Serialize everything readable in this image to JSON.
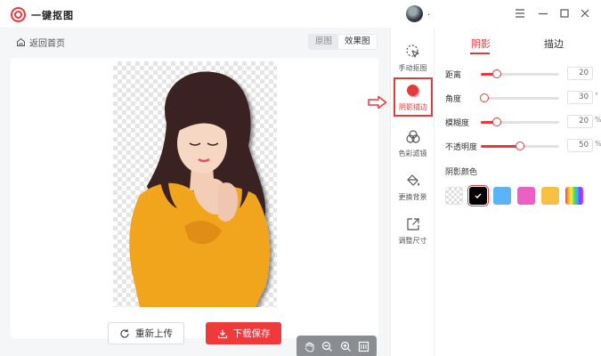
{
  "app": {
    "title": "一键抠图",
    "username": "."
  },
  "left": {
    "back_label": "返回首页",
    "view_toggle": {
      "original": "原图",
      "result": "效果图",
      "active": "result"
    }
  },
  "actions": {
    "reupload_label": "重新上传",
    "download_label": "下载保存"
  },
  "tools": [
    {
      "id": "manual",
      "label": "手动抠图",
      "icon": "cursor-click-icon",
      "active": false
    },
    {
      "id": "shadow-stroke",
      "label": "阴影描边",
      "icon": "shadow-dot-icon",
      "active": true
    },
    {
      "id": "color-filter",
      "label": "色彩滤镜",
      "icon": "color-circles-icon",
      "active": false
    },
    {
      "id": "bg",
      "label": "更换背景",
      "icon": "paint-bucket-icon",
      "active": false
    },
    {
      "id": "resize",
      "label": "调整尺寸",
      "icon": "resize-icon",
      "active": false
    }
  ],
  "panel": {
    "tabs": [
      {
        "label": "阴影",
        "active": true
      },
      {
        "label": "描边",
        "active": false
      }
    ],
    "sliders": [
      {
        "label": "距离",
        "value": "20",
        "unit": "",
        "fraction": 0.2
      },
      {
        "label": "角度",
        "value": "30",
        "unit": "°",
        "fraction": 0.05
      },
      {
        "label": "模糊度",
        "value": "20",
        "unit": "%",
        "fraction": 0.2
      },
      {
        "label": "不透明度",
        "value": "50",
        "unit": "%",
        "fraction": 0.5
      }
    ],
    "shadow_color_title": "阴影颜色",
    "swatches": [
      {
        "name": "transparent",
        "color": "transparent",
        "selected": false
      },
      {
        "name": "black",
        "color": "#000000",
        "selected": true
      },
      {
        "name": "blue",
        "color": "#5bb4f7",
        "selected": false
      },
      {
        "name": "pink",
        "color": "#ec5fc5",
        "selected": false
      },
      {
        "name": "yellow",
        "color": "#f5c043",
        "selected": false
      },
      {
        "name": "rainbow",
        "color": "rainbow",
        "selected": false
      }
    ]
  },
  "colors": {
    "accent": "#e53a3a"
  }
}
